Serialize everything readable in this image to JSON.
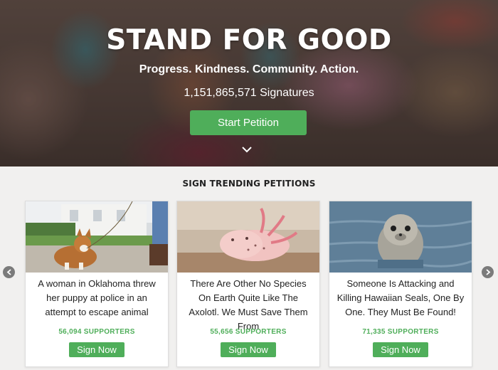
{
  "hero": {
    "title": "STAND FOR GOOD",
    "tagline": "Progress. Kindness. Community. Action.",
    "signature_count": "1,151,865,571 Signatures",
    "start_button": "Start Petition"
  },
  "trending": {
    "heading": "SIGN TRENDING PETITIONS",
    "petitions": [
      {
        "text": "A woman in Oklahoma threw her puppy at police in an attempt to escape animal",
        "supporters": "56,094 SUPPORTERS",
        "button": "Sign Now",
        "image": "dog-photo"
      },
      {
        "text": "There Are Other No Species On Earth Quite Like The Axolotl. We Must Save Them From",
        "supporters": "55,656 SUPPORTERS",
        "button": "Sign Now",
        "image": "axolotl-photo"
      },
      {
        "text": "Someone Is Attacking and Killing Hawaiian Seals, One By One. They Must Be Found!",
        "supporters": "71,335 SUPPORTERS",
        "button": "Sign Now",
        "image": "seal-photo"
      }
    ]
  },
  "colors": {
    "accent_green": "#4fae5a",
    "background": "#f1f0ef",
    "arrow_gray": "#7b7b7b"
  }
}
